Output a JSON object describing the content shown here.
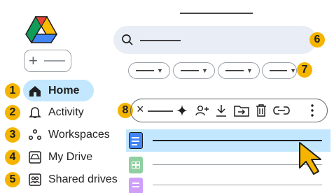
{
  "app": {
    "logo": "google-drive-logo-icon",
    "new_button_icon": "plus-icon"
  },
  "sidebar": {
    "items": [
      {
        "label": "Home",
        "icon": "home-icon",
        "badge": "1",
        "active": true
      },
      {
        "label": "Activity",
        "icon": "bell-icon",
        "badge": "2",
        "active": false
      },
      {
        "label": "Workspaces",
        "icon": "workspaces-icon",
        "badge": "3",
        "active": false
      },
      {
        "label": "My Drive",
        "icon": "drive-icon",
        "badge": "4",
        "active": false
      },
      {
        "label": "Shared drives",
        "icon": "shared-drives-icon",
        "badge": "5",
        "active": false
      }
    ]
  },
  "search": {
    "icon": "search-icon",
    "badge": "6"
  },
  "filters": {
    "badge": "7",
    "chip_count": 4
  },
  "action_bar": {
    "badge": "8",
    "icons": [
      "close-icon",
      "gemini-sparkle-icon",
      "share-icon",
      "download-icon",
      "move-icon",
      "trash-icon",
      "link-icon",
      "more-vert-icon"
    ]
  },
  "files": [
    {
      "type": "docs",
      "color": "#4285f4",
      "selected": true
    },
    {
      "type": "sheets",
      "color": "#34a853",
      "selected": false
    },
    {
      "type": "forms",
      "color": "#a142f4",
      "selected": false
    }
  ],
  "colors": {
    "accent": "#c2e7ff",
    "badge": "#f5b400",
    "search_bg": "#e9eef6",
    "cursor": "#f5b400"
  }
}
